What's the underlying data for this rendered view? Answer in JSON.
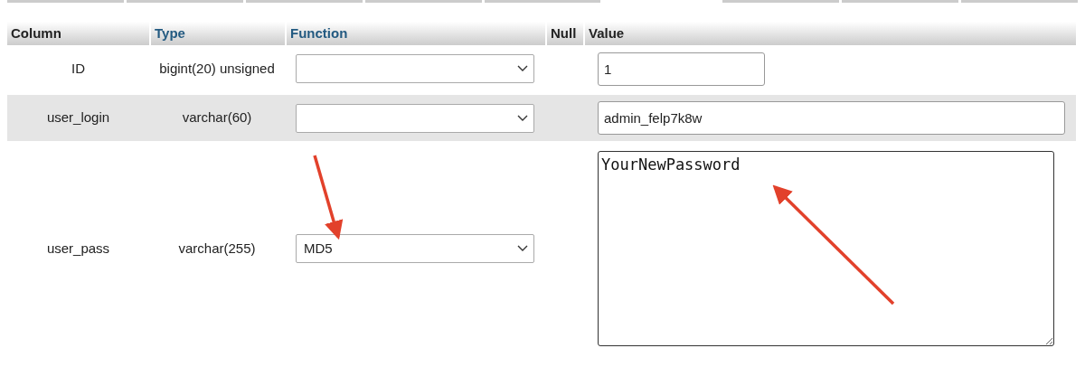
{
  "table": {
    "columns": [
      {
        "label": "Column",
        "link": false
      },
      {
        "label": "Type",
        "link": true
      },
      {
        "label": "Function",
        "link": true
      },
      {
        "label": "Null",
        "link": false
      },
      {
        "label": "Value",
        "link": false
      }
    ],
    "rows": [
      {
        "column": "ID",
        "type": "bigint(20) unsigned",
        "value": "1",
        "kind": "short"
      },
      {
        "column": "user_login",
        "type": "varchar(60)",
        "value": "admin_felp7k8w",
        "kind": "wide"
      },
      {
        "column": "user_pass",
        "type": "varchar(255)",
        "function": "MD5",
        "value": "YourNewPassword",
        "kind": "textarea"
      }
    ]
  }
}
